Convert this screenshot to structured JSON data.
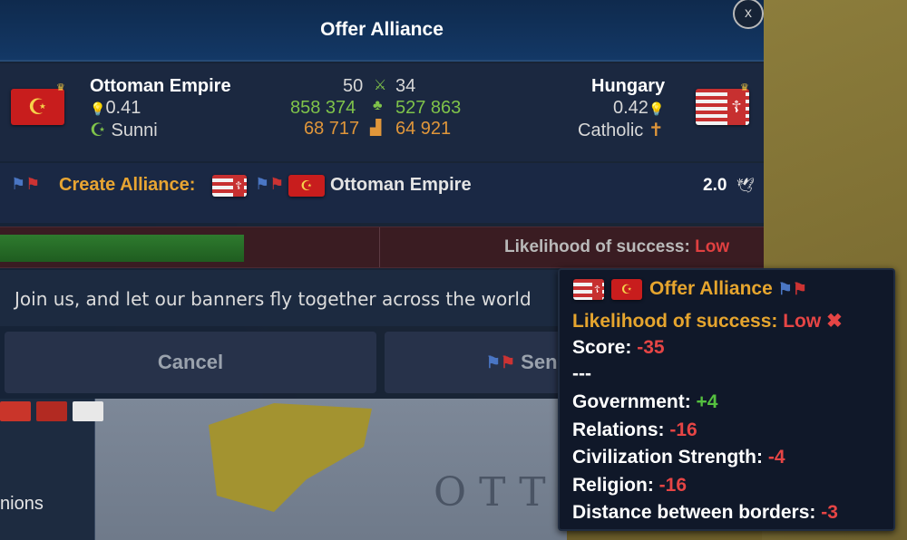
{
  "dialog": {
    "title": "Offer Alliance",
    "close_label": "x"
  },
  "left_country": {
    "name": "Ottoman Empire",
    "opinion": "0.41",
    "religion": "Sunni"
  },
  "right_country": {
    "name": "Hungary",
    "opinion": "0.42",
    "religion": "Catholic"
  },
  "comparison": {
    "row1_left": "50",
    "row1_right": "34",
    "row2_left": "858 374",
    "row2_right": "527 863",
    "row3_left": "68 717",
    "row3_right": "64 921"
  },
  "alliance": {
    "label": "Create Alliance:",
    "target": "Ottoman Empire",
    "score": "2.0"
  },
  "progress": {
    "fraction": 0.32,
    "likelihood_label": "Likelihood of success:",
    "likelihood_value": "Low"
  },
  "message": {
    "text": "Join us, and let our banners fly together across the world"
  },
  "buttons": {
    "cancel": "Cancel",
    "send": "Send Proposal"
  },
  "tooltip": {
    "title": "Offer Alliance",
    "likelihood_label": "Likelihood of success:",
    "likelihood_value": "Low",
    "score_label": "Score:",
    "score_value": "-35",
    "separator": "---",
    "factors": [
      {
        "label": "Government:",
        "value": "+4",
        "tone": "green"
      },
      {
        "label": "Relations:",
        "value": "-16",
        "tone": "red"
      },
      {
        "label": "Civilization Strength:",
        "value": "-4",
        "tone": "red"
      },
      {
        "label": "Religion:",
        "value": "-16",
        "tone": "red"
      },
      {
        "label": "Distance between borders:",
        "value": "-3",
        "tone": "red"
      }
    ]
  },
  "sidebar": {
    "label": "nions"
  },
  "map": {
    "region_text": "OTT"
  },
  "colors": {
    "accent_orange": "#e6a52e",
    "negative_red": "#e64545",
    "positive_green": "#55c13f",
    "header_blue": "#133866"
  }
}
